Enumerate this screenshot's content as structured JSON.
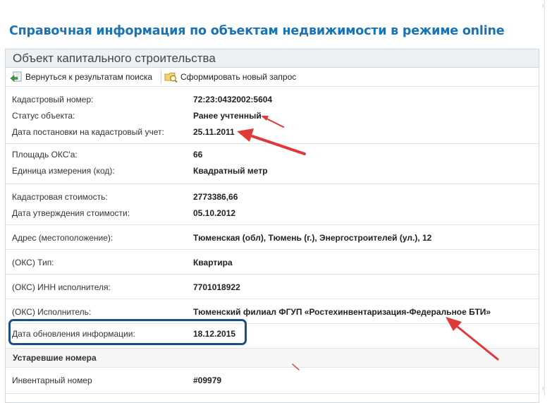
{
  "page": {
    "title": "Справочная информация по объектам недвижимости в режиме online"
  },
  "panel": {
    "title": "Объект капитального строительства",
    "toolbar": {
      "back_label": "Вернуться к результатам поиска",
      "new_query_label": "Сформировать новый запрос"
    },
    "groups": [
      [
        {
          "label": "Кадастровый номер:",
          "value": "72:23:0432002:5604"
        },
        {
          "label": "Статус объекта:",
          "value": "Ранее учтенный"
        },
        {
          "label": "Дата постановки на кадастровый учет:",
          "value": "25.11.2011"
        }
      ],
      [
        {
          "label": "Площадь ОКС'а:",
          "value": "66"
        },
        {
          "label": "Единица измерения (код):",
          "value": "Квадратный метр"
        }
      ],
      [
        {
          "label": "Кадастровая стоимость:",
          "value": "2773386,66"
        },
        {
          "label": "Дата утверждения стоимости:",
          "value": "05.10.2012"
        }
      ],
      [
        {
          "label": "Адрес (местоположение):",
          "value": "Тюменская (обл), Тюмень (г.), Энергостроителей (ул.), 12"
        }
      ],
      [
        {
          "label": "(ОКС) Тип:",
          "value": "Квартира"
        }
      ],
      [
        {
          "label": "(ОКС) ИНН исполнителя:",
          "value": "7701018922"
        }
      ],
      [
        {
          "label": "(ОКС) Исполнитель:",
          "value": "Тюменский филиал ФГУП «Ростехинвентаризация-Федеральное БТИ»"
        }
      ],
      [
        {
          "label": "Дата обновления информации:",
          "value": "18.12.2015"
        }
      ]
    ],
    "obsolete_section": {
      "title": "Устаревшие номера",
      "rows": [
        {
          "label": "Инвентарный номер",
          "value": "#09979"
        }
      ]
    }
  },
  "colors": {
    "title": "#1a73b5",
    "annotation_arrow": "#e0393a",
    "highlight_box": "#1a4e8a"
  }
}
